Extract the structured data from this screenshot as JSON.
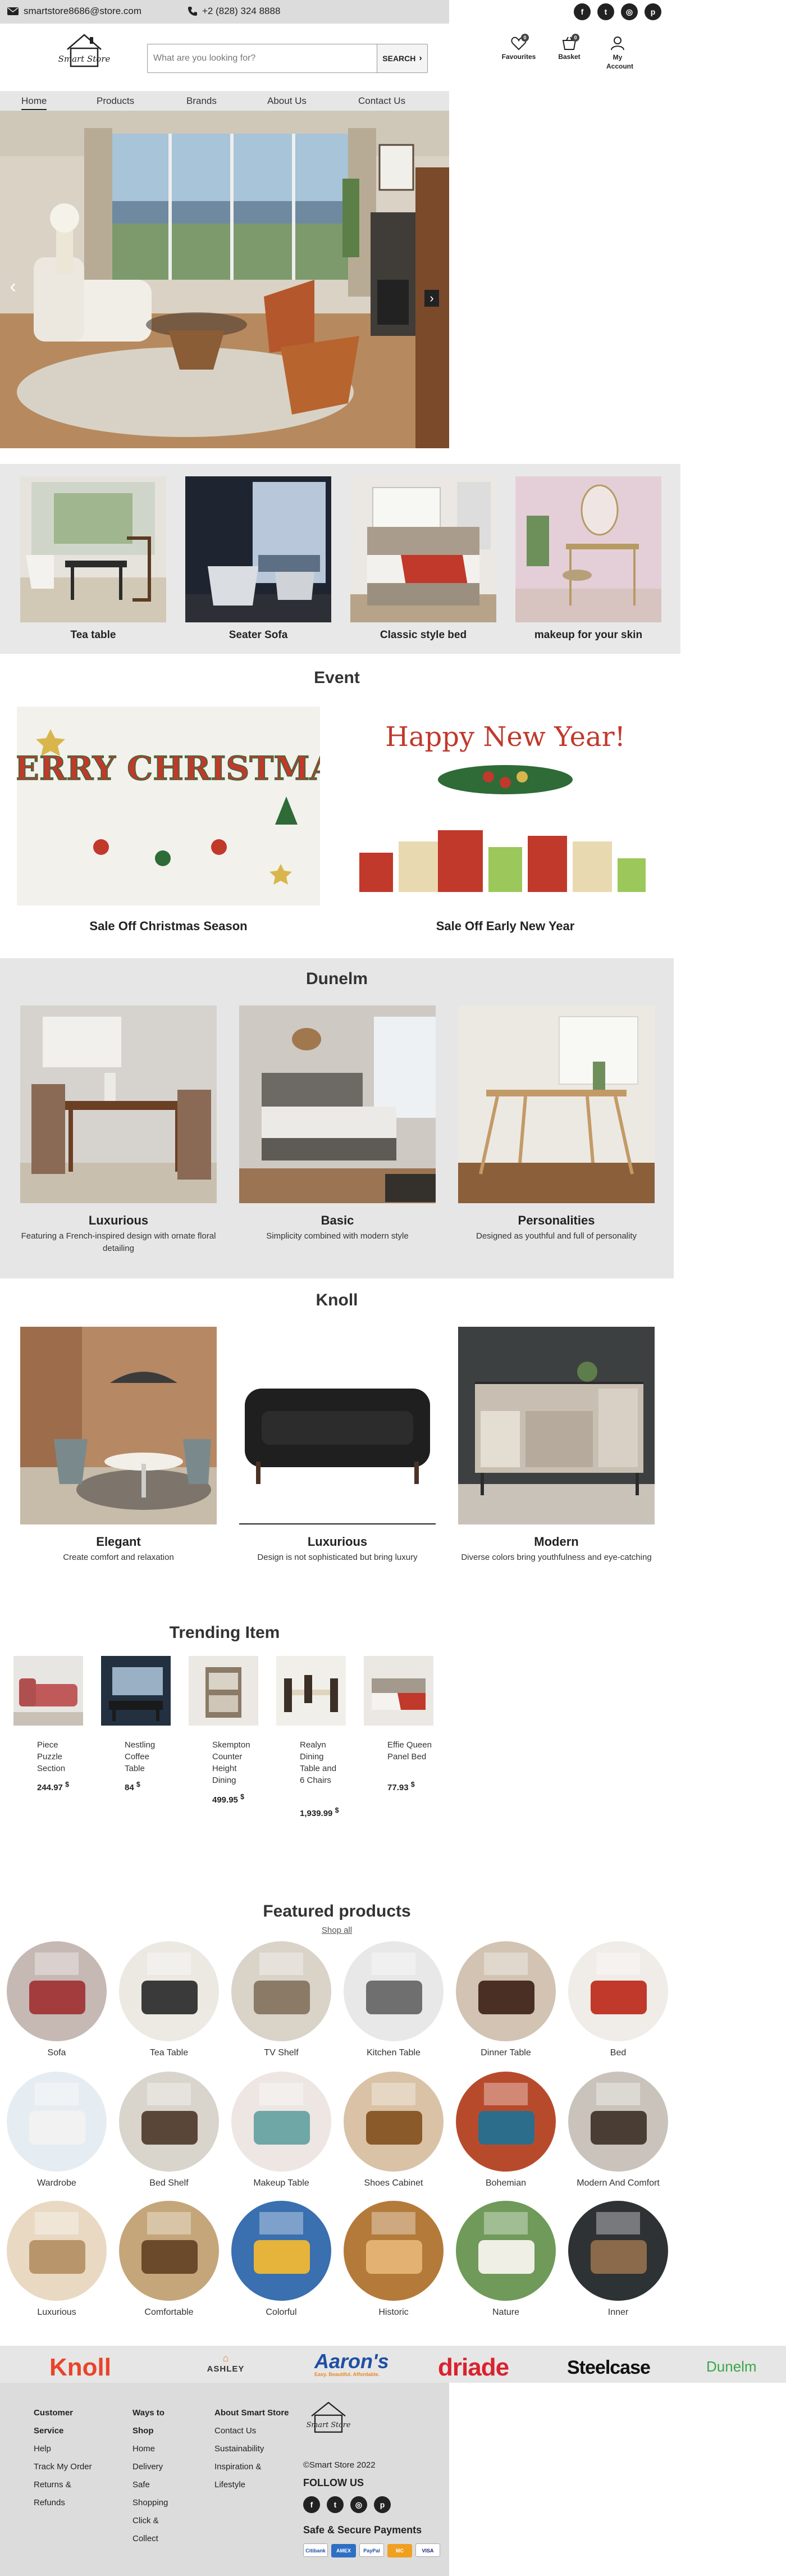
{
  "topbar": {
    "email": "smartstore8686@store.com",
    "phone": "+2 (828) 324 8888"
  },
  "header": {
    "search_placeholder": "What are you looking for?",
    "search_button": "SEARCH",
    "favourites": "Favourites",
    "basket": "Basket",
    "account": "My Account",
    "favourites_count": "0",
    "basket_count": "0"
  },
  "nav": {
    "items": [
      "Home",
      "Products",
      "Brands",
      "About Us",
      "Contact Us"
    ]
  },
  "categories": [
    "Tea table",
    "Seater Sofa",
    "Classic style bed",
    "makeup for your skin"
  ],
  "event": {
    "title": "Event",
    "christmas_art": "MERRY CHRISTMAS",
    "newyear_art": "Happy New Year!",
    "items": [
      "Sale Off Christmas Season",
      "Sale Off Early New Year"
    ]
  },
  "dunelm": {
    "title": "Dunelm",
    "items": [
      {
        "title": "Luxurious",
        "desc": "Featuring a French-inspired design with ornate floral detailing"
      },
      {
        "title": "Basic",
        "desc": "Simplicity combined with modern style"
      },
      {
        "title": "Personalities",
        "desc": "Designed as youthful and full of personality"
      }
    ]
  },
  "knoll": {
    "title": "Knoll",
    "items": [
      {
        "title": "Elegant",
        "desc": "Create comfort and relaxation"
      },
      {
        "title": "Luxurious",
        "desc": "Design is not sophisticated but bring luxury"
      },
      {
        "title": "Modern",
        "desc": "Diverse colors bring youthfulness and eye-catching"
      }
    ]
  },
  "trending": {
    "title": "Trending Item",
    "currency": "$",
    "items": [
      {
        "name": "Piece Puzzle Section",
        "price": "244.97"
      },
      {
        "name": "Nestling Coffee Table",
        "price": "84"
      },
      {
        "name": "Skempton Counter Height Dining",
        "price": "499.95"
      },
      {
        "name": "Realyn Dining Table and 6 Chairs",
        "price": "1,939.99"
      },
      {
        "name": "Effie Queen Panel Bed",
        "price": "77.93"
      }
    ]
  },
  "featured": {
    "title": "Featured products",
    "shop_all": "Shop all",
    "items": [
      "Sofa",
      "Tea Table",
      "TV Shelf",
      "Kitchen Table",
      "Dinner Table",
      "Bed",
      "Wardrobe",
      "Bed Shelf",
      "Makeup Table",
      "Shoes Cabinet",
      "Bohemian",
      "Modern And Comfort",
      "Luxurious",
      "Comfortable",
      "Colorful",
      "Historic",
      "Nature",
      "Inner"
    ]
  },
  "brands": [
    "Knoll",
    "ASHLEY",
    "Aaron's",
    "driade",
    "Steelcase",
    "Dunelm"
  ],
  "brand_tagline": "Easy. Beautiful. Affordable.",
  "footer": {
    "col1_title": "Customer Service",
    "col1": [
      "Help",
      "Track My Order",
      "Returns & Refunds"
    ],
    "col2_title": "Ways to Shop",
    "col2": [
      "Home Delivery",
      "Safe Shopping",
      "Click & Collect"
    ],
    "col3_title": "About Smart Store",
    "col3": [
      "Contact Us",
      "Sustainability",
      "Inspiration & Lifestyle"
    ],
    "logo_text": "Smart Store",
    "copyright": "©Smart Store 2022",
    "follow": "FOLLOW US",
    "payments_title": "Safe & Secure Payments",
    "payments": [
      "Citibank",
      "AMEX",
      "PayPal",
      "MC",
      "VISA"
    ]
  },
  "colors": {
    "accent": "#222222",
    "band": "#e6e6e6",
    "knoll_red": "#e8442a",
    "aarons_blue": "#1f4fa3",
    "driade_red": "#d9222f",
    "dunelm_green": "#3aa64a"
  }
}
